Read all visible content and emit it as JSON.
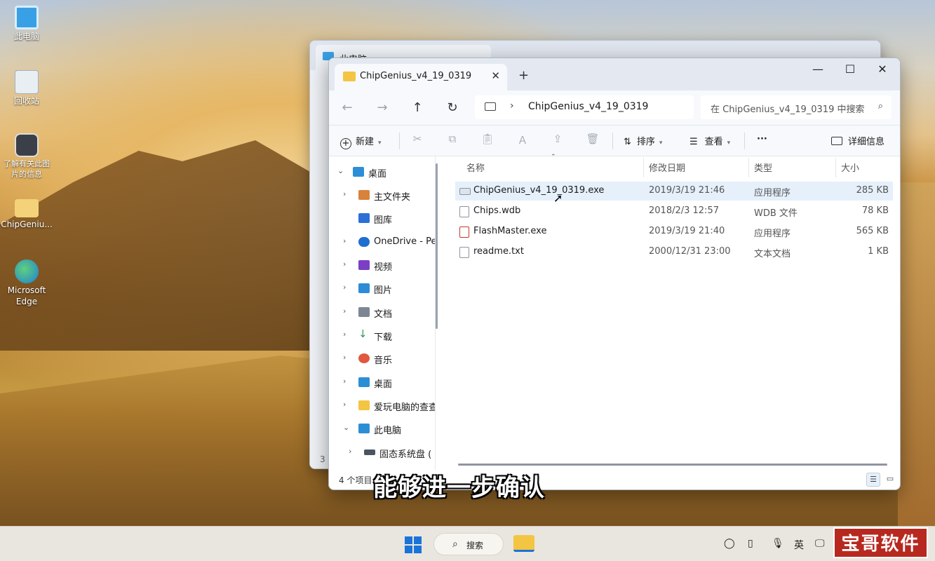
{
  "desktop": {
    "icons": [
      {
        "label": "此电脑"
      },
      {
        "label": "回收站"
      },
      {
        "label": "了解有关此图片的信息"
      },
      {
        "label": "ChipGeniu..."
      },
      {
        "label": "Microsoft Edge"
      }
    ]
  },
  "back_window": {
    "tab_title": "此电脑",
    "side_number": "3"
  },
  "window": {
    "tab_title": "ChipGenius_v4_19_0319",
    "tab_close": "✕",
    "new_tab": "+",
    "minimize": "—",
    "maximize": "☐",
    "close": "✕",
    "address_chevron": "›",
    "address_path": "ChipGenius_v4_19_0319",
    "search_placeholder": "在 ChipGenius_v4_19_0319 中搜索",
    "toolbar": {
      "new_label": "新建",
      "sort_label": "排序",
      "view_label": "查看",
      "more_label": "···",
      "details_label": "详细信息"
    },
    "nav_items": [
      {
        "label": "桌面",
        "expanded": true,
        "color": "#2c8fd6"
      },
      {
        "label": "主文件夹",
        "color": "#d9823b"
      },
      {
        "label": "图库",
        "color": "#2c6fd6"
      },
      {
        "label": "OneDrive - Pe",
        "color": "#1e6fd0"
      },
      {
        "label": "视频",
        "color": "#7b3fc4"
      },
      {
        "label": "图片",
        "color": "#2e8bd8"
      },
      {
        "label": "文档",
        "color": "#7d8794"
      },
      {
        "label": "下载",
        "color": "#2a9c5a"
      },
      {
        "label": "音乐",
        "color": "#e0593f"
      },
      {
        "label": "桌面",
        "color": "#2c8fd6"
      },
      {
        "label": "爱玩电脑的查查",
        "color": "#f4c542"
      },
      {
        "label": "此电脑",
        "expanded": true,
        "color": "#2c8fd6"
      },
      {
        "label": "固态系统盘 (",
        "color": "#4a5561"
      }
    ],
    "columns": {
      "name": "名称",
      "modified": "修改日期",
      "type": "类型",
      "size": "大小"
    },
    "files": [
      {
        "name": "ChipGenius_v4_19_0319.exe",
        "modified": "2019/3/19 21:46",
        "type": "应用程序",
        "size": "285 KB",
        "selected": true
      },
      {
        "name": "Chips.wdb",
        "modified": "2018/2/3 12:57",
        "type": "WDB 文件",
        "size": "78 KB"
      },
      {
        "name": "FlashMaster.exe",
        "modified": "2019/3/19 21:40",
        "type": "应用程序",
        "size": "565 KB"
      },
      {
        "name": "readme.txt",
        "modified": "2000/12/31 23:00",
        "type": "文本文档",
        "size": "1 KB"
      }
    ],
    "status_count": "4 个项目"
  },
  "caption": "能够进一步确认",
  "taskbar": {
    "search_label": "搜索",
    "ime": "英",
    "watermark": "宝哥软件园"
  },
  "colors": {
    "accent": "#1a73d9",
    "selection": "#e5f0fb",
    "folder": "#f4c542"
  }
}
